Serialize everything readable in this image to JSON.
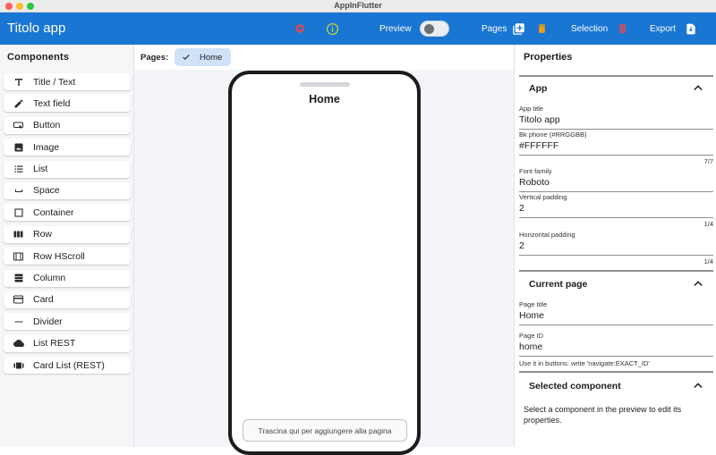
{
  "window": {
    "title": "AppInFlutter"
  },
  "appbar": {
    "title": "Titolo app",
    "preview_label": "Preview",
    "pages_label": "Pages",
    "selection_label": "Selection",
    "export_label": "Export",
    "colors": {
      "bar": "#1976d2",
      "settings_icon": "#e5484d",
      "info_icon": "#c7d934",
      "delete_icon": "#f59e0b",
      "selection_delete_icon": "#e5484d"
    }
  },
  "components": {
    "heading": "Components",
    "items": [
      {
        "label": "Title / Text",
        "icon": "title-icon"
      },
      {
        "label": "Text field",
        "icon": "pencil-icon"
      },
      {
        "label": "Button",
        "icon": "button-icon"
      },
      {
        "label": "Image",
        "icon": "image-icon"
      },
      {
        "label": "List",
        "icon": "list-icon"
      },
      {
        "label": "Space",
        "icon": "space-icon"
      },
      {
        "label": "Container",
        "icon": "container-icon"
      },
      {
        "label": "Row",
        "icon": "row-icon"
      },
      {
        "label": "Row HScroll",
        "icon": "row-hscroll-icon"
      },
      {
        "label": "Column",
        "icon": "column-icon"
      },
      {
        "label": "Card",
        "icon": "card-icon"
      },
      {
        "label": "Divider",
        "icon": "divider-icon"
      },
      {
        "label": "List REST",
        "icon": "cloud-icon"
      },
      {
        "label": "Card List (REST)",
        "icon": "card-list-icon"
      }
    ]
  },
  "pages": {
    "label": "Pages:",
    "chips": [
      {
        "label": "Home",
        "selected": true
      }
    ]
  },
  "preview": {
    "page_title": "Home",
    "drop_hint": "Trascina qui per aggiungere alla pagina"
  },
  "properties": {
    "heading": "Properties",
    "app_section": {
      "title": "App",
      "fields": {
        "app_title": {
          "label": "App title",
          "value": "Titolo app"
        },
        "bk_phone": {
          "label": "Bk phone (#RRGGBB)",
          "value": "#FFFFFF",
          "counter": "7/7"
        },
        "font_family": {
          "label": "Font family",
          "value": "Roboto"
        },
        "vertical_padding": {
          "label": "Vertical padding",
          "value": "2",
          "counter": "1/4"
        },
        "horizontal_padding": {
          "label": "Horizontal padding",
          "value": "2",
          "counter": "1/4"
        }
      }
    },
    "current_page_section": {
      "title": "Current page",
      "fields": {
        "page_title": {
          "label": "Page title",
          "value": "Home"
        },
        "page_id": {
          "label": "Page ID",
          "value": "home"
        }
      },
      "hint": "Use it in buttons: write 'navigate:EXACT_ID'"
    },
    "selected_component_section": {
      "title": "Selected component",
      "message": "Select a component in the preview to edit its properties."
    }
  }
}
